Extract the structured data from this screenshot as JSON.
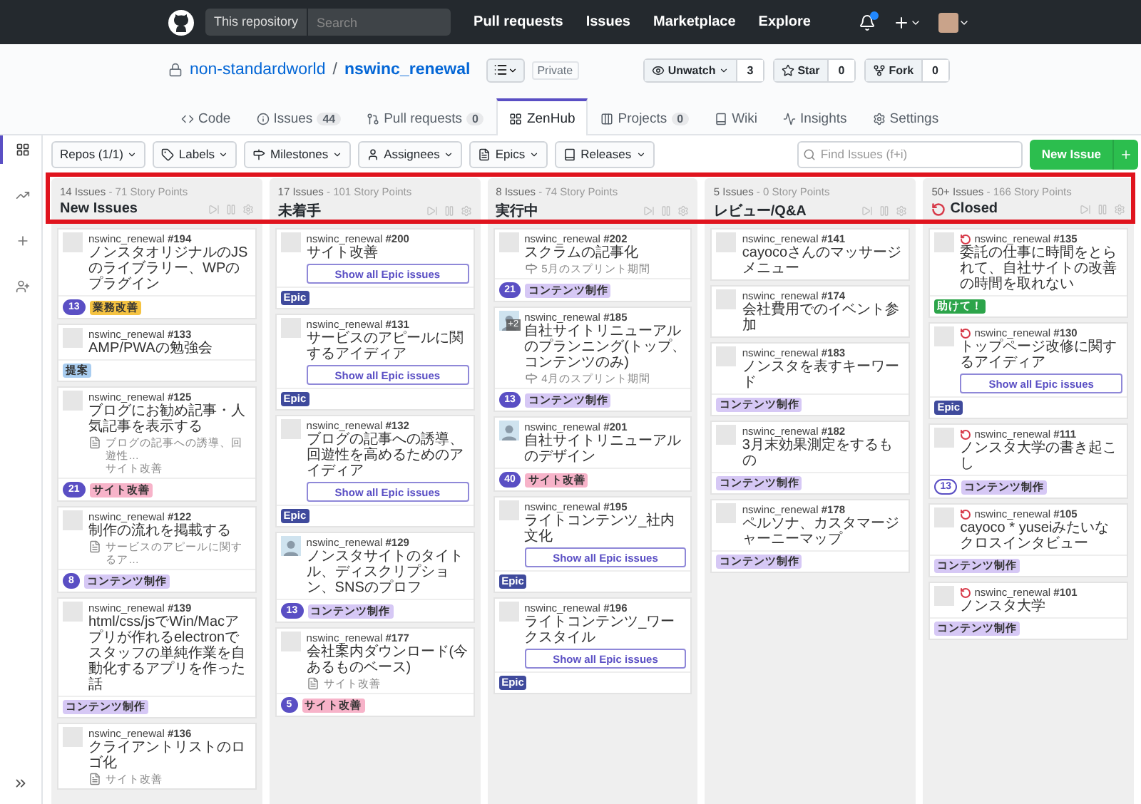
{
  "topbar": {
    "scope": "This repository",
    "search_placeholder": "Search",
    "links": [
      "Pull requests",
      "Issues",
      "Marketplace",
      "Explore"
    ],
    "notification": true
  },
  "repo": {
    "owner": "non-standardworld",
    "separator": "/",
    "name": "nswinc_renewal",
    "visibility": "Private",
    "actions": [
      {
        "kind": "watch",
        "label": "Unwatch",
        "count": "3"
      },
      {
        "kind": "star",
        "label": "Star",
        "count": "0"
      },
      {
        "kind": "fork",
        "label": "Fork",
        "count": "0"
      }
    ],
    "tabs": [
      {
        "kind": "code",
        "label": "Code",
        "selected": false
      },
      {
        "kind": "issues",
        "label": "Issues",
        "count": "44",
        "selected": false
      },
      {
        "kind": "pulls",
        "label": "Pull requests",
        "count": "0",
        "selected": false
      },
      {
        "kind": "zenhub",
        "label": "ZenHub",
        "selected": true
      },
      {
        "kind": "projects",
        "label": "Projects",
        "count": "0",
        "selected": false
      },
      {
        "kind": "wiki",
        "label": "Wiki",
        "selected": false
      },
      {
        "kind": "insights",
        "label": "Insights",
        "selected": false
      },
      {
        "kind": "settings",
        "label": "Settings",
        "selected": false
      }
    ]
  },
  "sidebar": {
    "items": [
      {
        "kind": "board",
        "selected": true
      },
      {
        "kind": "reports",
        "selected": false
      },
      {
        "kind": "add",
        "selected": false
      },
      {
        "kind": "invite",
        "selected": false
      }
    ]
  },
  "toolbar": {
    "filters": [
      {
        "kind": "repos",
        "label": "Repos (1/1)"
      },
      {
        "kind": "labels",
        "label": "Labels"
      },
      {
        "kind": "milestones",
        "label": "Milestones"
      },
      {
        "kind": "assignees",
        "label": "Assignees"
      },
      {
        "kind": "epics",
        "label": "Epics"
      },
      {
        "kind": "releases",
        "label": "Releases"
      }
    ],
    "search_placeholder": "Find Issues (f+i)",
    "new_issue": "New Issue"
  },
  "pipelines": [
    {
      "name": "New Issues",
      "count": "14 Issues",
      "points": "- 71 Story Points",
      "closed": false,
      "cards": [
        {
          "repo": "nswinc_renewal",
          "number": "#194",
          "title": "ノンスタオリジナルのJSのライブラリー、WPのプラグイン",
          "photo": false,
          "closed": false,
          "estimate": {
            "text": "13",
            "filled": true
          },
          "labels": [
            {
              "text": "業務改善",
              "color": "#f5c342"
            }
          ]
        },
        {
          "repo": "nswinc_renewal",
          "number": "#133",
          "title": "AMP/PWAの勉強会",
          "photo": false,
          "closed": false,
          "labels": [
            {
              "text": "提案",
              "color": "#a9cdf0"
            }
          ]
        },
        {
          "repo": "nswinc_renewal",
          "number": "#125",
          "title": "ブログにお勧め記事・人気記事を表示する",
          "photo": false,
          "closed": false,
          "meta": {
            "kind": "epic",
            "text": "ブログの記事への誘導、回遊性…",
            "subtext": "サイト改善"
          },
          "estimate": {
            "text": "21",
            "filled": true
          },
          "labels": [
            {
              "text": "サイト改善",
              "color": "#f7b3c9"
            }
          ]
        },
        {
          "repo": "nswinc_renewal",
          "number": "#122",
          "title": "制作の流れを掲載する",
          "photo": false,
          "closed": false,
          "meta": {
            "kind": "epic",
            "text": "サービスのアピールに関するア…"
          },
          "estimate": {
            "text": "8",
            "filled": true
          },
          "labels": [
            {
              "text": "コンテンツ制作",
              "color": "#d6c8f5"
            }
          ]
        },
        {
          "repo": "nswinc_renewal",
          "number": "#139",
          "title": "html/css/jsでWin/Macアプリが作れるelectronでスタッフの単純作業を自動化するアプリを作った話",
          "photo": false,
          "closed": false,
          "labels": [
            {
              "text": "コンテンツ制作",
              "color": "#d6c8f5"
            }
          ]
        },
        {
          "repo": "nswinc_renewal",
          "number": "#136",
          "title": "クライアントリストのロゴ化",
          "photo": false,
          "closed": false,
          "meta": {
            "kind": "epic",
            "text": "サイト改善"
          }
        }
      ]
    },
    {
      "name": "未着手",
      "count": "17 Issues",
      "points": "- 101 Story Points",
      "closed": false,
      "cards": [
        {
          "repo": "nswinc_renewal",
          "number": "#200",
          "title": "サイト改善",
          "photo": false,
          "closed": false,
          "epic_button": "Show all Epic issues",
          "labels": [
            {
              "text": "Epic",
              "color": "#3f4a9c"
            }
          ]
        },
        {
          "repo": "nswinc_renewal",
          "number": "#131",
          "title": "サービスのアピールに関するアイディア",
          "photo": false,
          "closed": false,
          "epic_button": "Show all Epic issues",
          "labels": [
            {
              "text": "Epic",
              "color": "#3f4a9c"
            }
          ]
        },
        {
          "repo": "nswinc_renewal",
          "number": "#132",
          "title": "ブログの記事への誘導、回遊性を高めるためのアイディア",
          "photo": false,
          "closed": false,
          "epic_button": "Show all Epic issues",
          "labels": [
            {
              "text": "Epic",
              "color": "#3f4a9c"
            }
          ]
        },
        {
          "repo": "nswinc_renewal",
          "number": "#129",
          "title": "ノンスタサイトのタイトル、ディスクリプション、SNSのプロフ",
          "photo": true,
          "closed": false,
          "estimate": {
            "text": "13",
            "filled": true
          },
          "labels": [
            {
              "text": "コンテンツ制作",
              "color": "#d6c8f5"
            }
          ]
        },
        {
          "repo": "nswinc_renewal",
          "number": "#177",
          "title": "会社案内ダウンロード(今あるものベース)",
          "photo": false,
          "closed": false,
          "meta": {
            "kind": "epic",
            "text": "サイト改善"
          },
          "estimate": {
            "text": "5",
            "filled": true
          },
          "labels": [
            {
              "text": "サイト改善",
              "color": "#f7b3c9"
            }
          ]
        }
      ]
    },
    {
      "name": "実行中",
      "count": "8 Issues",
      "points": "- 74 Story Points",
      "closed": false,
      "cards": [
        {
          "repo": "nswinc_renewal",
          "number": "#202",
          "title": "スクラムの記事化",
          "photo": false,
          "closed": false,
          "meta": {
            "kind": "milestone",
            "text": "5月のスプリント期間"
          },
          "estimate": {
            "text": "21",
            "filled": true
          },
          "labels": [
            {
              "text": "コンテンツ制作",
              "color": "#d6c8f5"
            }
          ]
        },
        {
          "repo": "nswinc_renewal",
          "number": "#185",
          "title": "自社サイトリニューアルのプランニング(トップ、コンテンツのみ)",
          "photo": true,
          "avatar_extra": "+2",
          "closed": false,
          "meta": {
            "kind": "milestone",
            "text": "4月のスプリント期間"
          },
          "estimate": {
            "text": "13",
            "filled": true
          },
          "labels": [
            {
              "text": "コンテンツ制作",
              "color": "#d6c8f5"
            }
          ]
        },
        {
          "repo": "nswinc_renewal",
          "number": "#201",
          "title": "自社サイトリニューアルのデザイン",
          "photo": true,
          "closed": false,
          "estimate": {
            "text": "40",
            "filled": true
          },
          "labels": [
            {
              "text": "サイト改善",
              "color": "#f7b3c9"
            }
          ]
        },
        {
          "repo": "nswinc_renewal",
          "number": "#195",
          "title": "ライトコンテンツ_社内文化",
          "photo": false,
          "closed": false,
          "epic_button": "Show all Epic issues",
          "labels": [
            {
              "text": "Epic",
              "color": "#3f4a9c"
            }
          ]
        },
        {
          "repo": "nswinc_renewal",
          "number": "#196",
          "title": "ライトコンテンツ_ワークスタイル",
          "photo": false,
          "closed": false,
          "epic_button": "Show all Epic issues",
          "labels": [
            {
              "text": "Epic",
              "color": "#3f4a9c"
            }
          ]
        }
      ]
    },
    {
      "name": "レビュー/Q&A",
      "count": "5 Issues",
      "points": "- 0 Story Points",
      "closed": false,
      "cards": [
        {
          "repo": "nswinc_renewal",
          "number": "#141",
          "title": "cayocoさんのマッサージメニュー",
          "photo": false,
          "closed": false
        },
        {
          "repo": "nswinc_renewal",
          "number": "#174",
          "title": "会社費用でのイベント参加",
          "photo": false,
          "closed": false
        },
        {
          "repo": "nswinc_renewal",
          "number": "#183",
          "title": "ノンスタを表すキーワード",
          "photo": false,
          "closed": false,
          "labels": [
            {
              "text": "コンテンツ制作",
              "color": "#d6c8f5"
            }
          ]
        },
        {
          "repo": "nswinc_renewal",
          "number": "#182",
          "title": "3月末効果測定をするもの",
          "photo": false,
          "closed": false,
          "labels": [
            {
              "text": "コンテンツ制作",
              "color": "#d6c8f5"
            }
          ]
        },
        {
          "repo": "nswinc_renewal",
          "number": "#178",
          "title": "ペルソナ、カスタマージャーニーマップ",
          "photo": false,
          "closed": false,
          "labels": [
            {
              "text": "コンテンツ制作",
              "color": "#d6c8f5"
            }
          ]
        }
      ]
    },
    {
      "name": "Closed",
      "count": "50+ Issues",
      "points": "- 166 Story Points",
      "closed": true,
      "cards": [
        {
          "repo": "nswinc_renewal",
          "number": "#135",
          "title": "委託の仕事に時間をとられて、自社サイトの改善の時間を取れない",
          "photo": false,
          "closed": true,
          "labels": [
            {
              "text": "助けて！",
              "color": "#2ca44a"
            }
          ]
        },
        {
          "repo": "nswinc_renewal",
          "number": "#130",
          "title": "トップページ改修に関するアイディア",
          "photo": false,
          "closed": true,
          "epic_button": "Show all Epic issues",
          "labels": [
            {
              "text": "Epic",
              "color": "#3f4a9c"
            }
          ]
        },
        {
          "repo": "nswinc_renewal",
          "number": "#111",
          "title": "ノンスタ大学の書き起こし",
          "photo": false,
          "closed": true,
          "estimate": {
            "text": "13",
            "filled": false
          },
          "labels": [
            {
              "text": "コンテンツ制作",
              "color": "#d6c8f5"
            }
          ]
        },
        {
          "repo": "nswinc_renewal",
          "number": "#105",
          "title": "cayoco * yuseiみたいなクロスインタビュー",
          "photo": false,
          "closed": true,
          "labels": [
            {
              "text": "コンテンツ制作",
              "color": "#d6c8f5"
            }
          ]
        },
        {
          "repo": "nswinc_renewal",
          "number": "#101",
          "title": "ノンスタ大学",
          "photo": false,
          "closed": true,
          "labels": [
            {
              "text": "コンテンツ制作",
              "color": "#d6c8f5"
            }
          ]
        }
      ]
    }
  ]
}
